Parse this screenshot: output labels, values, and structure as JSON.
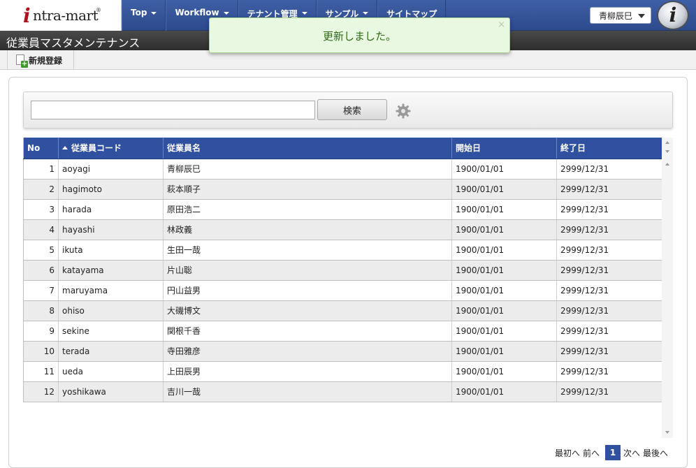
{
  "brand": {
    "logo_letter": "i",
    "logo_text": "ntra-mart",
    "logo_mark": "®",
    "corner_logo": "i"
  },
  "nav": {
    "items": [
      {
        "label": "Top"
      },
      {
        "label": "Workflow"
      },
      {
        "label": "テナント管理"
      },
      {
        "label": "サンプル"
      },
      {
        "label": "サイトマップ"
      }
    ]
  },
  "user": {
    "name": "青柳辰巳"
  },
  "page": {
    "title": "従業員マスタメンテナンス"
  },
  "toolbar": {
    "new_label": "新規登録"
  },
  "toast": {
    "message": "更新しました。",
    "close": "×"
  },
  "search": {
    "value": "",
    "placeholder": "",
    "button_label": "検索"
  },
  "table": {
    "headers": [
      "No",
      "従業員コード",
      "従業員名",
      "開始日",
      "終了日"
    ],
    "rows": [
      {
        "no": "1",
        "code": "aoyagi",
        "name": "青柳辰巳",
        "start": "1900/01/01",
        "end": "2999/12/31"
      },
      {
        "no": "2",
        "code": "hagimoto",
        "name": "萩本順子",
        "start": "1900/01/01",
        "end": "2999/12/31"
      },
      {
        "no": "3",
        "code": "harada",
        "name": "原田浩二",
        "start": "1900/01/01",
        "end": "2999/12/31"
      },
      {
        "no": "4",
        "code": "hayashi",
        "name": "林政義",
        "start": "1900/01/01",
        "end": "2999/12/31"
      },
      {
        "no": "5",
        "code": "ikuta",
        "name": "生田一哉",
        "start": "1900/01/01",
        "end": "2999/12/31"
      },
      {
        "no": "6",
        "code": "katayama",
        "name": "片山聡",
        "start": "1900/01/01",
        "end": "2999/12/31"
      },
      {
        "no": "7",
        "code": "maruyama",
        "name": "円山益男",
        "start": "1900/01/01",
        "end": "2999/12/31"
      },
      {
        "no": "8",
        "code": "ohiso",
        "name": "大磯博文",
        "start": "1900/01/01",
        "end": "2999/12/31"
      },
      {
        "no": "9",
        "code": "sekine",
        "name": "関根千香",
        "start": "1900/01/01",
        "end": "2999/12/31"
      },
      {
        "no": "10",
        "code": "terada",
        "name": "寺田雅彦",
        "start": "1900/01/01",
        "end": "2999/12/31"
      },
      {
        "no": "11",
        "code": "ueda",
        "name": "上田辰男",
        "start": "1900/01/01",
        "end": "2999/12/31"
      },
      {
        "no": "12",
        "code": "yoshikawa",
        "name": "吉川一哉",
        "start": "1900/01/01",
        "end": "2999/12/31"
      }
    ]
  },
  "pager": {
    "first": "最初へ",
    "prev": "前へ",
    "current": "1",
    "next": "次へ",
    "last": "最後へ"
  },
  "colors": {
    "accent": "#2f51a0",
    "toast_bg": "#e9f8e1",
    "toast_text": "#2d6b15"
  }
}
